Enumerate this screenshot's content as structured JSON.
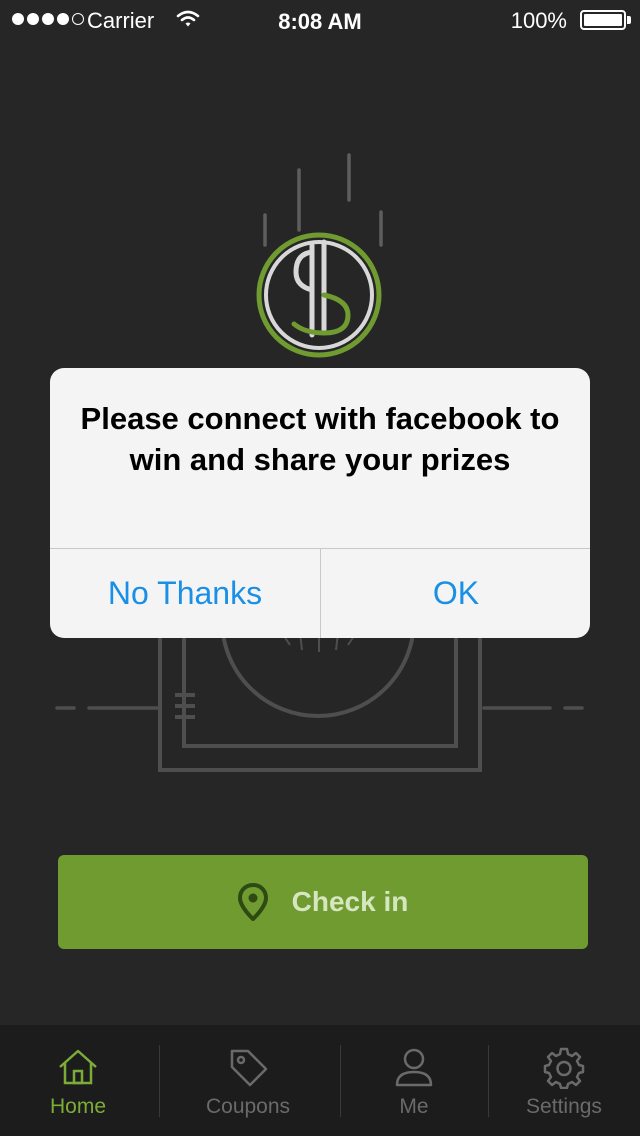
{
  "status_bar": {
    "carrier": "Carrier",
    "time": "8:08 AM",
    "battery": "100%",
    "signal_icons": [
      "signal-dot",
      "signal-dot",
      "signal-dot",
      "signal-dot",
      "signal-dot-empty"
    ],
    "wifi_icon": "wifi-icon",
    "battery_icon": "battery-icon"
  },
  "alert": {
    "message": "Please connect with facebook to win and share your prizes",
    "cancel_label": "No Thanks",
    "ok_label": "OK"
  },
  "checkin": {
    "label": "Check in",
    "icon": "map-pin-icon"
  },
  "tabs": [
    {
      "label": "Home",
      "icon": "home-icon",
      "active": true
    },
    {
      "label": "Coupons",
      "icon": "tag-icon",
      "active": false
    },
    {
      "label": "Me",
      "icon": "user-icon",
      "active": false
    },
    {
      "label": "Settings",
      "icon": "gear-icon",
      "active": false
    }
  ],
  "colors": {
    "background": "#262626",
    "accent_green": "#6f9b30",
    "alert_button_blue": "#1a8fe6",
    "tab_active": "#7cac37",
    "tab_inactive": "#6a6a6a"
  }
}
